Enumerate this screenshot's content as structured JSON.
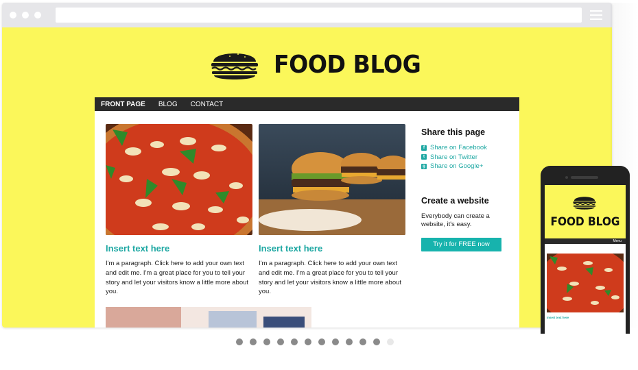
{
  "browser": {
    "address_bar_value": "",
    "menu_icon": "hamburger-icon"
  },
  "site": {
    "brand_title": "FOOD BLOG",
    "logo_icon": "burger-icon",
    "background": "#fbf75a",
    "accent": "#1fa8a3",
    "nav": {
      "items": [
        {
          "label": "FRONT PAGE",
          "active": true
        },
        {
          "label": "BLOG",
          "active": false
        },
        {
          "label": "CONTACT",
          "active": false
        }
      ]
    },
    "cards": [
      {
        "image": "pizza-photo",
        "title": "Insert text here",
        "text": "I'm a paragraph. Click here to add your own text and edit me. I'm a great place for you to tell your story and let your visitors know a little more about you."
      },
      {
        "image": "burgers-photo",
        "title": "Insert text here",
        "text": "I'm a paragraph. Click here to add your own text and edit me. I'm a great place for you to tell your story and let your visitors know a little more about you."
      }
    ],
    "sidebar": {
      "share_heading": "Share this page",
      "share_links": [
        {
          "label": "Share on Facebook",
          "icon": "facebook-icon"
        },
        {
          "label": "Share on Twitter",
          "icon": "twitter-icon"
        },
        {
          "label": "Share on Google+",
          "icon": "google-plus-icon"
        }
      ],
      "create_heading": "Create a website",
      "create_text": "Everybody can create a website, it's easy.",
      "cta_label": "Try it for FREE now"
    }
  },
  "pager": {
    "total": 12,
    "current_inactive_index": 11
  },
  "mobile": {
    "brand_title": "FOOD BLOG",
    "menu_label": "Menu",
    "card_title": "Insert text here"
  }
}
